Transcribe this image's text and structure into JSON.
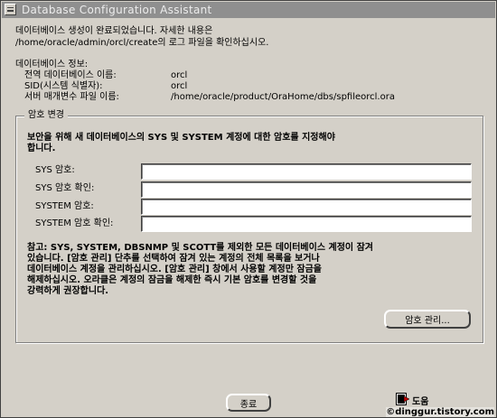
{
  "window": {
    "title": "Database Configuration Assistant"
  },
  "intro": {
    "line1": "데이터베이스 생성이 완료되었습니다. 자세한 내용은",
    "line2": "/home/oracle/admin/orcl/create의 로그 파일을 확인하십시오."
  },
  "db_info": {
    "heading": "데이터베이스 정보:",
    "rows": [
      {
        "label": "전역 데이터베이스 이름:",
        "value": "orcl"
      },
      {
        "label": "SID(시스템 식별자):",
        "value": "orcl"
      },
      {
        "label": "서버 매개변수 파일 이름:",
        "value": "/home/oracle/product/OraHome/dbs/spfileorcl.ora"
      }
    ]
  },
  "password": {
    "legend": "암호 변경",
    "instruction_line1": "보안을 위해 새 데이터베이스의 SYS 및 SYSTEM 계정에 대한 암호를 지정해야",
    "instruction_line2": "합니다.",
    "fields": [
      {
        "label": "SYS 암호:",
        "value": ""
      },
      {
        "label": "SYS 암호 확인:",
        "value": ""
      },
      {
        "label": "SYSTEM 암호:",
        "value": ""
      },
      {
        "label": "SYSTEM 암호 확인:",
        "value": ""
      }
    ],
    "note": [
      "참고: SYS, SYSTEM, DBSNMP 및 SCOTT를 제외한 모든 데이터베이스 계정이 잠겨",
      "있습니다. [암호 관리] 단추를 선택하여 잠겨 있는 계정의 전체 목록을 보거나",
      "데이터베이스 계정을 관리하십시오. [암호 관리] 창에서 사용할 계정만 잠금을",
      "해제하십시오. 오라클은 계정의 잠금을 해제한 즉시 기본 암호를 변경할 것을",
      "강력하게 권장합니다."
    ],
    "manage_button": "암호 관리..."
  },
  "footer": {
    "close_button": "종료",
    "help_label": "도움말",
    "help_visible": "도움",
    "watermark": "©dinggur.tistory.com"
  },
  "colors": {
    "window_bg": "#d4d0c8",
    "titlebar_bg": "#8f8f8f",
    "help_icon_red": "#c00000"
  }
}
